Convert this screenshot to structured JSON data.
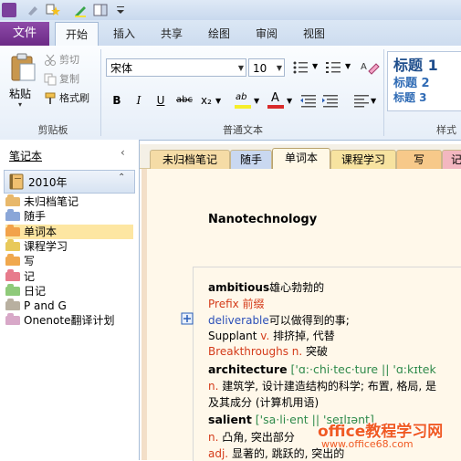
{
  "ribbon_tabs": {
    "file": "文件",
    "home": "开始",
    "insert": "插入",
    "share": "共享",
    "draw": "绘图",
    "review": "审阅",
    "view": "视图"
  },
  "clipboard": {
    "paste": "粘贴",
    "cut": "剪切",
    "copy": "复制",
    "format_painter": "格式刷",
    "group_label": "剪贴板"
  },
  "basic_text": {
    "font": "宋体",
    "size": "10",
    "bold": "B",
    "italic": "I",
    "underline": "U",
    "strikethrough": "abc",
    "subscript": "x₂",
    "highlight": "ab",
    "font_color": "A",
    "group_label": "普通文本"
  },
  "styles": {
    "heading1": "标题 1",
    "heading2": "标题 2",
    "heading3": "标题 3",
    "group_label": "样式"
  },
  "nav": {
    "header": "笔记本",
    "notebook": "2010年",
    "sections": [
      {
        "label": "未归档笔记",
        "color": "#e8b86b"
      },
      {
        "label": "随手",
        "color": "#8aa6d8"
      },
      {
        "label": "单词本",
        "color": "#f2a24a"
      },
      {
        "label": "课程学习",
        "color": "#e8c95b"
      },
      {
        "label": "写",
        "color": "#f0a84e"
      },
      {
        "label": "记",
        "color": "#e77b8c"
      },
      {
        "label": "日记",
        "color": "#8fca7a"
      },
      {
        "label": "P and G",
        "color": "#b8b0a0"
      },
      {
        "label": "Onenote翻译计划",
        "color": "#d8a8c8"
      }
    ]
  },
  "section_tabs": [
    {
      "label": "未归档笔记",
      "color": "#f5dca6"
    },
    {
      "label": "随手",
      "color": "#c9d8f0"
    },
    {
      "label": "单词本",
      "color": "#fff8e6"
    },
    {
      "label": "课程学习",
      "color": "#f7e3a0"
    },
    {
      "label": "写",
      "color": "#f7c98a"
    },
    {
      "label": "记",
      "color": "#f3b7c0"
    }
  ],
  "page": {
    "title": "Nanotechnology",
    "lines": [
      {
        "parts": [
          {
            "t": "ambitious",
            "c": "bold"
          },
          {
            "t": "雄心勃勃的",
            "c": ""
          }
        ]
      },
      {
        "parts": [
          {
            "t": "Prefix  前缀",
            "c": "red"
          }
        ]
      },
      {
        "parts": [
          {
            "t": "deliverable",
            "c": "blue"
          },
          {
            "t": "可以做得到的事;",
            "c": ""
          }
        ]
      },
      {
        "parts": [
          {
            "t": "Supplant ",
            "c": ""
          },
          {
            "t": "v.",
            "c": "red"
          },
          {
            "t": "  排挤掉, 代替",
            "c": ""
          }
        ]
      },
      {
        "parts": [
          {
            "t": "Breakthroughs  n.",
            "c": "red"
          },
          {
            "t": "  突破",
            "c": ""
          }
        ]
      },
      {
        "parts": [
          {
            "t": "architecture",
            "c": "bold"
          },
          {
            "t": "  ['ɑ:·chi·tec·ture || 'ɑ:kɪtek",
            "c": "green"
          }
        ]
      },
      {
        "parts": [
          {
            "t": "n.",
            "c": "red"
          },
          {
            "t": "  建筑学, 设计建造结构的科学; 布置, 格局, 是",
            "c": ""
          }
        ]
      },
      {
        "parts": [
          {
            "t": "及其成分 (计算机用语)",
            "c": ""
          }
        ]
      },
      {
        "parts": [
          {
            "t": "salient",
            "c": "bold"
          },
          {
            "t": "  ['sa·li·ent || 'seɪlɪənt]",
            "c": "green"
          }
        ]
      },
      {
        "parts": [
          {
            "t": "n.",
            "c": "red"
          },
          {
            "t": "  凸角, 突出部分",
            "c": ""
          }
        ]
      },
      {
        "parts": [
          {
            "t": "adj.",
            "c": "red"
          },
          {
            "t": "  显著的, 跳跃的, 突出的",
            "c": ""
          }
        ]
      }
    ]
  },
  "watermark": {
    "line1": "office教程学习网",
    "line2": "www.office68.com"
  }
}
